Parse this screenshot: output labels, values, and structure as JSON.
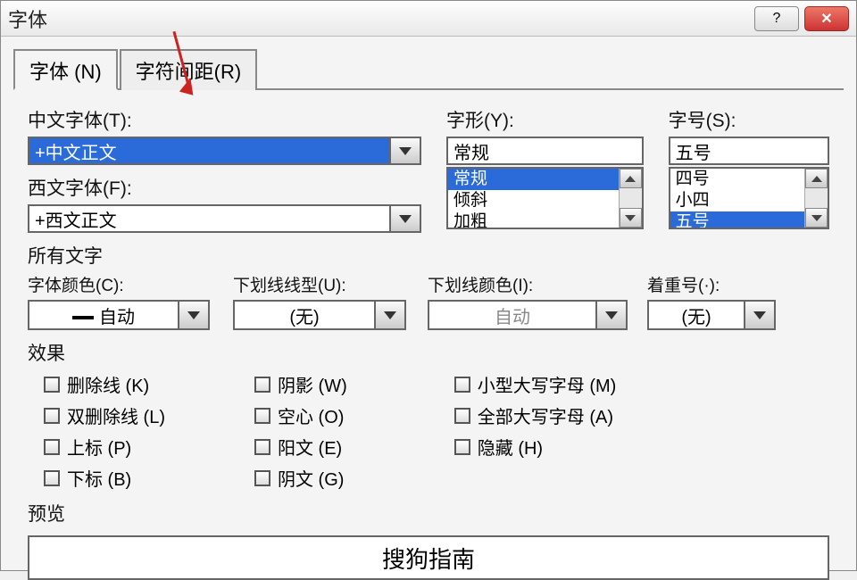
{
  "window": {
    "title": "字体"
  },
  "tabs": {
    "font": "字体 (N)",
    "spacing": "字符间距(R)"
  },
  "labels": {
    "chineseFont": "中文字体(T):",
    "westernFont": "西文字体(F):",
    "fontStyle": "字形(Y):",
    "fontSize": "字号(S):",
    "allText": "所有文字",
    "fontColor": "字体颜色(C):",
    "underlineStyle": "下划线线型(U):",
    "underlineColor": "下划线颜色(I):",
    "emphasis": "着重号(·):",
    "effects": "效果",
    "preview": "预览"
  },
  "values": {
    "chineseFont": "+中文正文",
    "westernFont": "+西文正文",
    "fontStyle": "常规",
    "fontSize": "五号",
    "fontColor": "自动",
    "underlineStyle": "(无)",
    "underlineColor": "自动",
    "emphasis": "(无)",
    "previewText": "搜狗指南"
  },
  "styleList": [
    "常规",
    "倾斜",
    "加粗"
  ],
  "sizeList": [
    "四号",
    "小四",
    "五号"
  ],
  "effectsCol1": [
    {
      "label": "删除线 (K)"
    },
    {
      "label": "双删除线 (L)"
    },
    {
      "label": "上标 (P)"
    },
    {
      "label": "下标 (B)"
    }
  ],
  "effectsCol2": [
    {
      "label": "阴影 (W)"
    },
    {
      "label": "空心 (O)"
    },
    {
      "label": "阳文 (E)"
    },
    {
      "label": "阴文 (G)"
    }
  ],
  "effectsCol3": [
    {
      "label": "小型大写字母 (M)"
    },
    {
      "label": "全部大写字母 (A)"
    },
    {
      "label": "隐藏 (H)"
    }
  ]
}
